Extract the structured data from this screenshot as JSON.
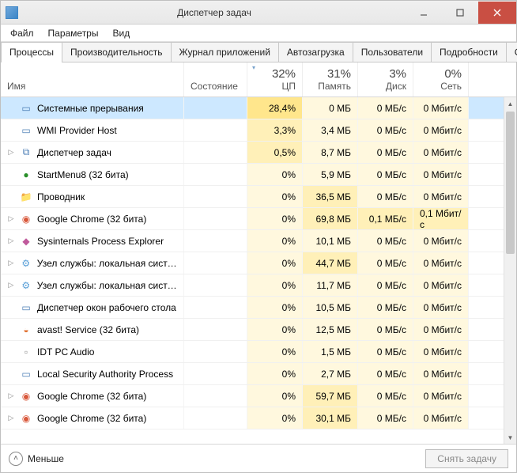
{
  "window": {
    "title": "Диспетчер задач"
  },
  "menu": {
    "file": "Файл",
    "options": "Параметры",
    "view": "Вид"
  },
  "tabs": [
    {
      "label": "Процессы"
    },
    {
      "label": "Производительность"
    },
    {
      "label": "Журнал приложений"
    },
    {
      "label": "Автозагрузка"
    },
    {
      "label": "Пользователи"
    },
    {
      "label": "Подробности"
    },
    {
      "label": "С"
    }
  ],
  "columns": {
    "name": "Имя",
    "state": "Состояние",
    "cpu": {
      "pct": "32%",
      "label": "ЦП"
    },
    "memory": {
      "pct": "31%",
      "label": "Память"
    },
    "disk": {
      "pct": "3%",
      "label": "Диск"
    },
    "network": {
      "pct": "0%",
      "label": "Сеть"
    }
  },
  "processes": [
    {
      "expand": "",
      "icon": "window-icon",
      "name": "Системные прерывания",
      "cpu": "28,4%",
      "mem": "0 МБ",
      "disk": "0 МБ/с",
      "net": "0 Мбит/с",
      "selected": true,
      "cpuheat": 3,
      "memheat": 1,
      "diskheat": 1,
      "netheat": 1
    },
    {
      "expand": "",
      "icon": "window-icon",
      "name": "WMI Provider Host",
      "cpu": "3,3%",
      "mem": "3,4 МБ",
      "disk": "0 МБ/с",
      "net": "0 Мбит/с",
      "cpuheat": 2,
      "memheat": 1,
      "diskheat": 1,
      "netheat": 1
    },
    {
      "expand": "▷",
      "icon": "taskmgr-icon",
      "name": "Диспетчер задач",
      "cpu": "0,5%",
      "mem": "8,7 МБ",
      "disk": "0 МБ/с",
      "net": "0 Мбит/с",
      "cpuheat": 2,
      "memheat": 1,
      "diskheat": 1,
      "netheat": 1
    },
    {
      "expand": "",
      "icon": "globe-icon",
      "name": "StartMenu8 (32 бита)",
      "cpu": "0%",
      "mem": "5,9 МБ",
      "disk": "0 МБ/с",
      "net": "0 Мбит/с",
      "cpuheat": 1,
      "memheat": 1,
      "diskheat": 1,
      "netheat": 1
    },
    {
      "expand": "",
      "icon": "folder-icon",
      "name": "Проводник",
      "cpu": "0%",
      "mem": "36,5 МБ",
      "disk": "0 МБ/с",
      "net": "0 Мбит/с",
      "cpuheat": 1,
      "memheat": 2,
      "diskheat": 1,
      "netheat": 1
    },
    {
      "expand": "▷",
      "icon": "chrome-icon",
      "name": "Google Chrome (32 бита)",
      "cpu": "0%",
      "mem": "69,8 МБ",
      "disk": "0,1 МБ/с",
      "net": "0,1 Мбит/с",
      "cpuheat": 1,
      "memheat": 2,
      "diskheat": 2,
      "netheat": 2
    },
    {
      "expand": "▷",
      "icon": "procexp-icon",
      "name": "Sysinternals Process Explorer",
      "cpu": "0%",
      "mem": "10,1 МБ",
      "disk": "0 МБ/с",
      "net": "0 Мбит/с",
      "cpuheat": 1,
      "memheat": 1,
      "diskheat": 1,
      "netheat": 1
    },
    {
      "expand": "▷",
      "icon": "gear-icon",
      "name": "Узел службы: локальная систе...",
      "cpu": "0%",
      "mem": "44,7 МБ",
      "disk": "0 МБ/с",
      "net": "0 Мбит/с",
      "cpuheat": 1,
      "memheat": 2,
      "diskheat": 1,
      "netheat": 1
    },
    {
      "expand": "▷",
      "icon": "gear-icon",
      "name": "Узел службы: локальная систе...",
      "cpu": "0%",
      "mem": "11,7 МБ",
      "disk": "0 МБ/с",
      "net": "0 Мбит/с",
      "cpuheat": 1,
      "memheat": 1,
      "diskheat": 1,
      "netheat": 1
    },
    {
      "expand": "",
      "icon": "window-icon",
      "name": "Диспетчер окон рабочего стола",
      "cpu": "0%",
      "mem": "10,5 МБ",
      "disk": "0 МБ/с",
      "net": "0 Мбит/с",
      "cpuheat": 1,
      "memheat": 1,
      "diskheat": 1,
      "netheat": 1
    },
    {
      "expand": "",
      "icon": "avast-icon",
      "name": "avast! Service (32 бита)",
      "cpu": "0%",
      "mem": "12,5 МБ",
      "disk": "0 МБ/с",
      "net": "0 Мбит/с",
      "cpuheat": 1,
      "memheat": 1,
      "diskheat": 1,
      "netheat": 1
    },
    {
      "expand": "",
      "icon": "generic-icon",
      "name": "IDT PC Audio",
      "cpu": "0%",
      "mem": "1,5 МБ",
      "disk": "0 МБ/с",
      "net": "0 Мбит/с",
      "cpuheat": 1,
      "memheat": 1,
      "diskheat": 1,
      "netheat": 1
    },
    {
      "expand": "",
      "icon": "window-icon",
      "name": "Local Security Authority Process",
      "cpu": "0%",
      "mem": "2,7 МБ",
      "disk": "0 МБ/с",
      "net": "0 Мбит/с",
      "cpuheat": 1,
      "memheat": 1,
      "diskheat": 1,
      "netheat": 1
    },
    {
      "expand": "▷",
      "icon": "chrome-icon",
      "name": "Google Chrome (32 бита)",
      "cpu": "0%",
      "mem": "59,7 МБ",
      "disk": "0 МБ/с",
      "net": "0 Мбит/с",
      "cpuheat": 1,
      "memheat": 2,
      "diskheat": 1,
      "netheat": 1
    },
    {
      "expand": "▷",
      "icon": "chrome-icon",
      "name": "Google Chrome (32 бита)",
      "cpu": "0%",
      "mem": "30,1 МБ",
      "disk": "0 МБ/с",
      "net": "0 Мбит/с",
      "cpuheat": 1,
      "memheat": 2,
      "diskheat": 1,
      "netheat": 1
    }
  ],
  "footer": {
    "less": "Меньше",
    "end_task": "Снять задачу"
  },
  "icons": {
    "window-icon": "▭",
    "taskmgr-icon": "⧉",
    "globe-icon": "●",
    "folder-icon": "📁",
    "chrome-icon": "◉",
    "procexp-icon": "◆",
    "gear-icon": "⚙",
    "avast-icon": "◒",
    "generic-icon": "▫"
  },
  "icon_colors": {
    "window-icon": "#4a7db5",
    "taskmgr-icon": "#4a7db5",
    "globe-icon": "#2a8f2a",
    "folder-icon": "#e0a030",
    "chrome-icon": "#d9583b",
    "procexp-icon": "#c05a9c",
    "gear-icon": "#5aa0d8",
    "avast-icon": "#e07030",
    "generic-icon": "#888"
  }
}
